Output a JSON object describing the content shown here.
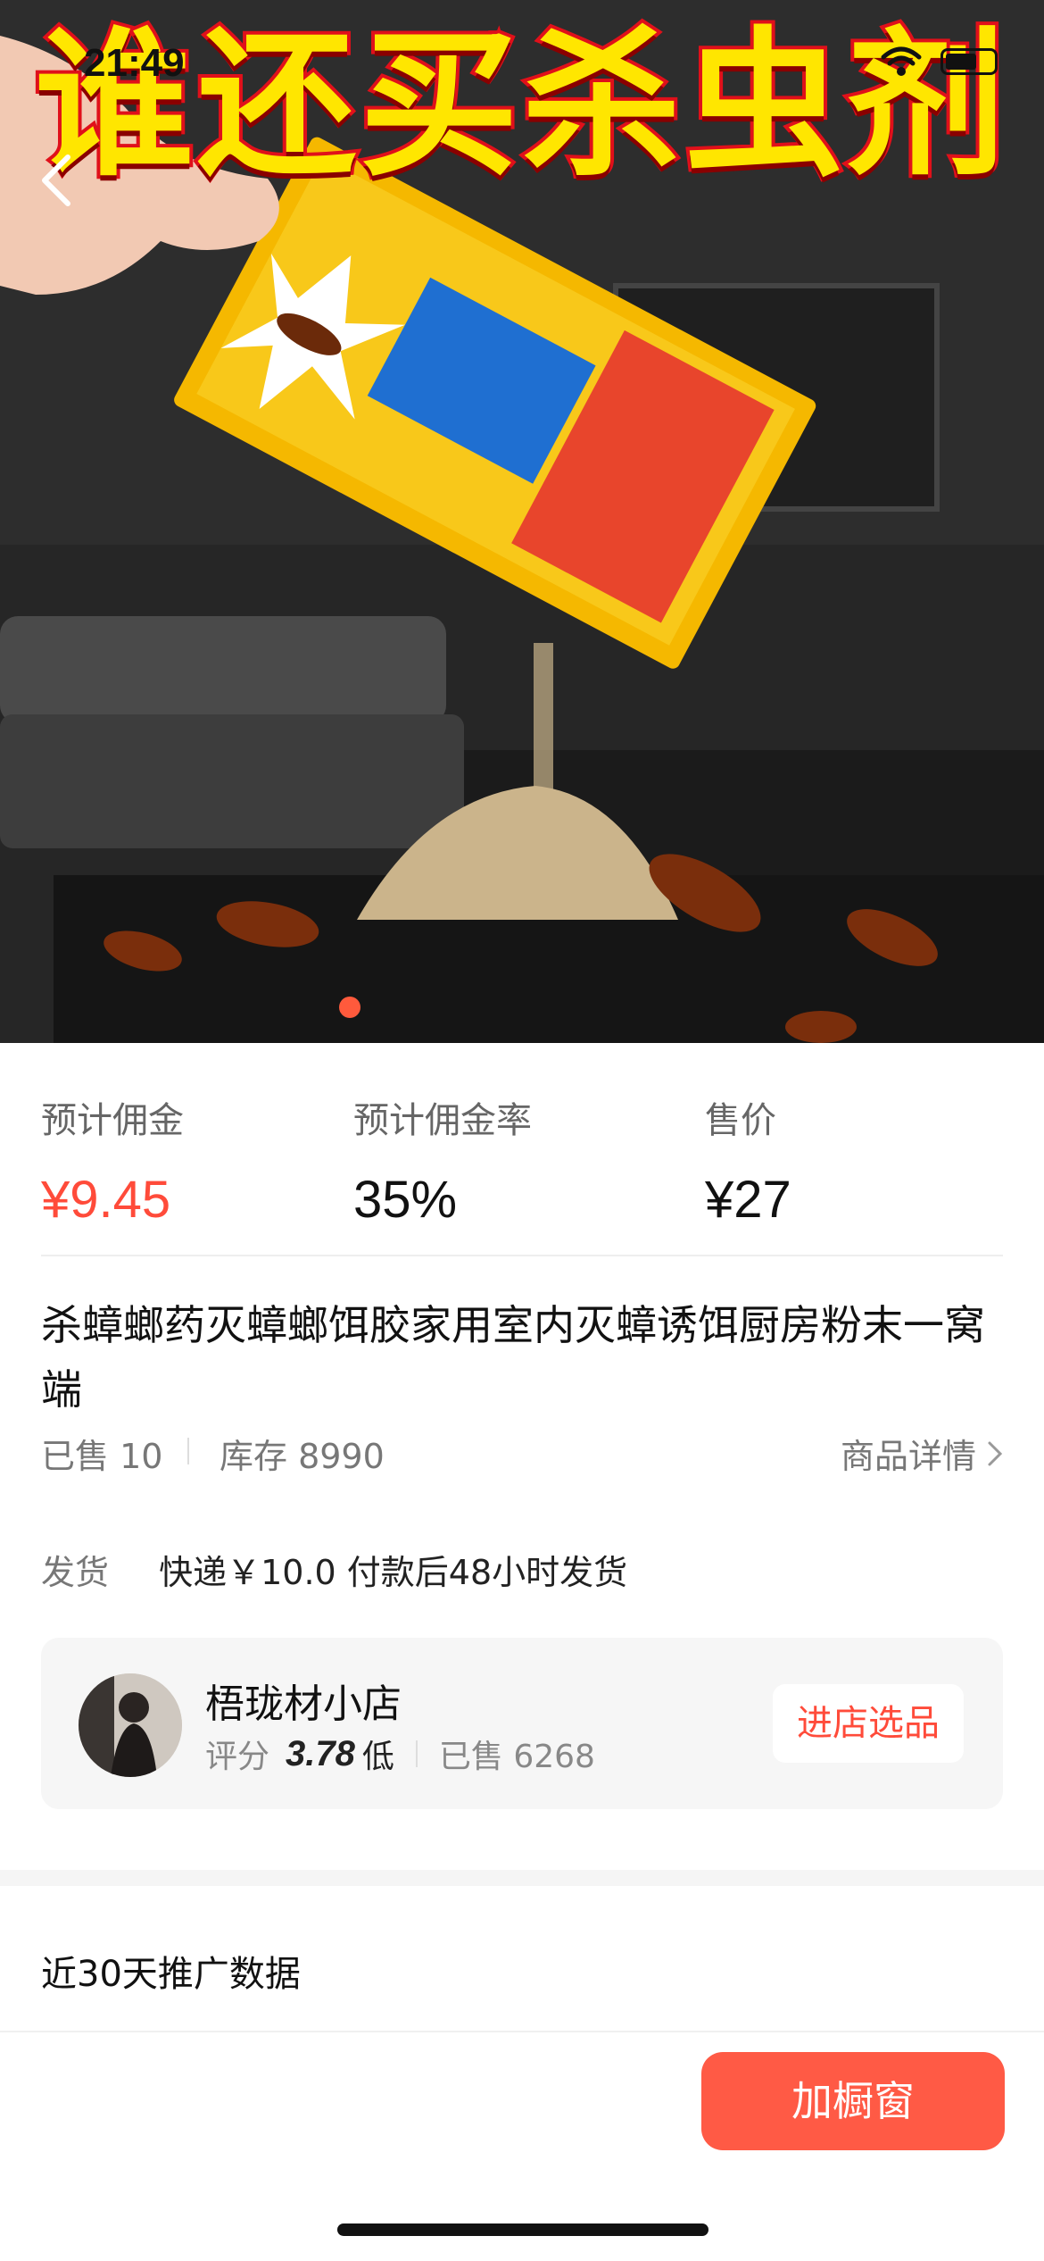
{
  "status_bar": {
    "time": "21:49"
  },
  "hero": {
    "headline": "谁还买杀虫剂"
  },
  "stats": [
    {
      "label": "预计佣金",
      "value": "¥9.45",
      "color": "#ff4b3a"
    },
    {
      "label": "预计佣金率",
      "value": "35%"
    },
    {
      "label": "售价",
      "value": "¥27"
    }
  ],
  "product": {
    "title": "杀蟑螂药灭蟑螂饵胶家用室内灭蟑诱饵厨房粉末一窝端",
    "sold": "已售 10",
    "stock": "库存 8990",
    "detail_link": "商品详情"
  },
  "shipping": {
    "label": "发货",
    "info": "快递￥10.0 付款后48小时发货"
  },
  "shop": {
    "name": "梧珑材小店",
    "score_label": "评分",
    "score": "3.78",
    "score_level": "低",
    "sold": "已售 6268",
    "button": "进店选品"
  },
  "promo_section": {
    "title": "近30天推广数据"
  },
  "bottom_bar": {
    "add_button": "加橱窗"
  },
  "colors": {
    "accent": "#ff5a45",
    "price": "#ff4b3a"
  }
}
